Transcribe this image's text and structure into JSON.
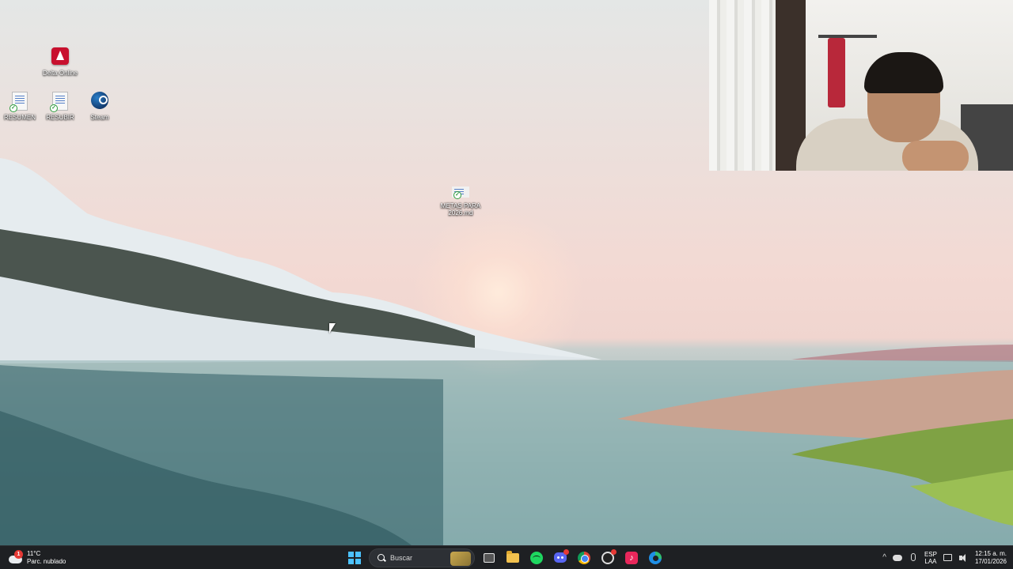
{
  "desktop": {
    "icons": [
      {
        "id": "delta-online",
        "label": "Delta Online",
        "icon": "delta-online-icon"
      },
      {
        "id": "resumen",
        "label": "RESUMEN",
        "icon": "spreadsheet-file-icon"
      },
      {
        "id": "resubir",
        "label": "RESUBIR",
        "icon": "document-file-icon"
      },
      {
        "id": "steam",
        "label": "Steam",
        "icon": "steam-icon"
      },
      {
        "id": "metas",
        "label": "METAS PARA 2026.md",
        "icon": "markdown-file-icon"
      }
    ]
  },
  "taskbar": {
    "weather": {
      "temp": "11°C",
      "condition": "Parc. nublado",
      "icon": "cloud-weather-icon",
      "badge": "1"
    },
    "search_label": "Buscar",
    "apps": [
      {
        "name": "start",
        "icon": "windows-start-icon"
      },
      {
        "name": "task-view",
        "icon": "task-view-icon"
      },
      {
        "name": "file-explorer",
        "icon": "folder-icon"
      },
      {
        "name": "spotify",
        "icon": "spotify-icon"
      },
      {
        "name": "discord",
        "icon": "discord-icon"
      },
      {
        "name": "chrome",
        "icon": "chrome-icon"
      },
      {
        "name": "obs",
        "icon": "obs-icon"
      },
      {
        "name": "tiktok",
        "icon": "tiktok-icon"
      },
      {
        "name": "edge",
        "icon": "edge-icon"
      }
    ],
    "tray": {
      "language_top": "ESP",
      "language_bottom": "LAA",
      "time": "12:15 a. m.",
      "date": "17/01/2026"
    }
  },
  "colors": {
    "taskbar_bg": "#1e2023",
    "start_accent": "#4cc2ff",
    "spotify": "#1ed760",
    "discord": "#5865f2"
  }
}
